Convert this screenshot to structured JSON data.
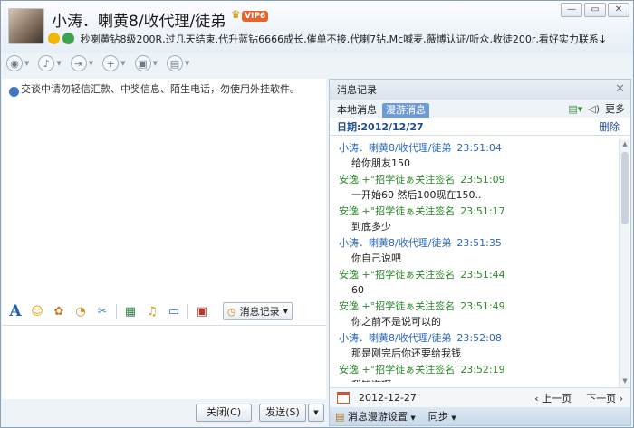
{
  "window": {
    "nickname": "小涛．喇黄8/收代理/徒弟",
    "vip_badge": "VIP6",
    "signature": "秒喇黄钻8级200R,过几天结束.代升蓝钻6666成长,催单不接,代喇7钻,Mc喊麦,薇博认证/听众,收徒200r,看好实力联系↓"
  },
  "window_buttons": [
    "—",
    "▭",
    "✕"
  ],
  "chat": {
    "notice": "交谈中请勿轻信汇款、中奖信息、陌生电话，勿使用外挂软件。",
    "msg_record_btn": "消息记录",
    "close_btn": "关闭(C)",
    "send_btn": "发送(S)"
  },
  "history": {
    "title": "消息记录",
    "tab_local": "本地消息",
    "tab_roam": "漫游消息",
    "more": "更多",
    "date_label": "日期:2012/12/27",
    "delete": "删除",
    "messages": [
      {
        "sender": "小涛．喇黄8/收代理/徒弟",
        "time": "23:51:04",
        "text": "给你朋友150",
        "color": "blue"
      },
      {
        "sender": "安逸 +°招学徒ぁ关注签名",
        "time": "23:51:09",
        "text": "一开始60 然后100现在150..",
        "color": "green"
      },
      {
        "sender": "安逸 +°招学徒ぁ关注签名",
        "time": "23:51:17",
        "text": "到底多少",
        "color": "green"
      },
      {
        "sender": "小涛．喇黄8/收代理/徒弟",
        "time": "23:51:35",
        "text": "你自己说吧",
        "color": "blue"
      },
      {
        "sender": "安逸 +°招学徒ぁ关注签名",
        "time": "23:51:44",
        "text": "60",
        "color": "green"
      },
      {
        "sender": "安逸 +°招学徒ぁ关注签名",
        "time": "23:51:49",
        "text": "你之前不是说可以的",
        "color": "green"
      },
      {
        "sender": "小涛．喇黄8/收代理/徒弟",
        "time": "23:52:08",
        "text": "那是刚完后你还要给我钱",
        "color": "blue"
      },
      {
        "sender": "安逸 +°招学徒ぁ关注签名",
        "time": "23:52:19",
        "text": "我知道啊",
        "color": "green"
      }
    ],
    "footer_date": "2012-12-27",
    "prev_page": "上一页",
    "next_page": "下一页",
    "roam_settings": "消息漫游设置",
    "sync": "同步"
  },
  "colors": {
    "blue_sender": "#2a6ac0",
    "green_sender": "#2f8a2f",
    "accent_tab": "#6f9bd3"
  },
  "icons": {
    "toolbar": [
      "video-call-icon",
      "voice-call-icon",
      "file-transfer-icon",
      "add-friend-icon",
      "screen-share-icon",
      "app-icon"
    ],
    "format": [
      "font-icon",
      "emoji-icon",
      "magic-emoji-icon",
      "nudge-icon",
      "screenshot-icon",
      "image-icon",
      "music-icon",
      "remote-icon",
      "gift-icon"
    ]
  }
}
